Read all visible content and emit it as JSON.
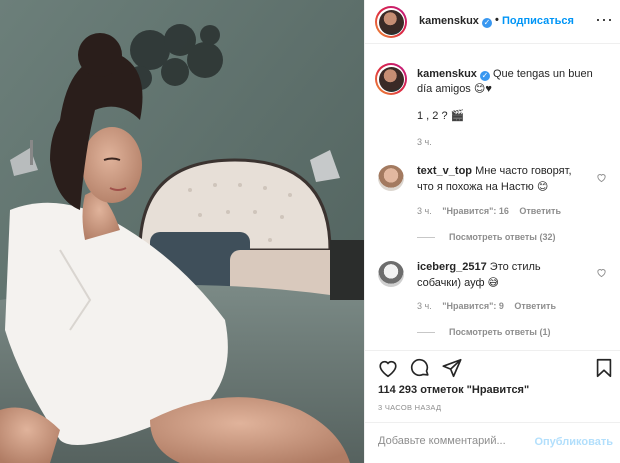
{
  "post": {
    "author": "kamenskux",
    "follow_label": "Подписаться",
    "dot": "•",
    "more": "···"
  },
  "caption": {
    "user": "kamenskux",
    "text": "Que tengas un buen día amigos 😊♥",
    "line2": "1 , 2 ? 🎬",
    "time": "3 ч."
  },
  "comments": [
    {
      "user": "text_v_top",
      "text": "Мне часто говорят, что я похожа на Настю 😊",
      "time": "3 ч.",
      "likes": "\"Нравится\": 16",
      "reply": "Ответить",
      "view_replies": "Посмотреть ответы (32)"
    },
    {
      "user": "iceberg_2517",
      "text": "Это стиль собачки) ауф 😅",
      "time": "3 ч.",
      "likes": "\"Нравится\": 9",
      "reply": "Ответить",
      "view_replies": "Посмотреть ответы (1)"
    }
  ],
  "likes_text": "114 293 отметок \"Нравится\"",
  "time_ago": "3 ЧАСОВ НАЗАД",
  "comment_input": {
    "placeholder": "Добавьте комментарий...",
    "submit": "Опубликовать"
  },
  "icons": {
    "like": "heart-icon",
    "comment": "comment-icon",
    "share": "share-icon",
    "save": "bookmark-icon",
    "verified": "verified-badge-icon",
    "more": "more-options-icon"
  },
  "colors": {
    "link": "#0095f6",
    "muted": "#8e8e8e",
    "verified": "#3897f0",
    "publish_disabled": "#b2dffc"
  }
}
